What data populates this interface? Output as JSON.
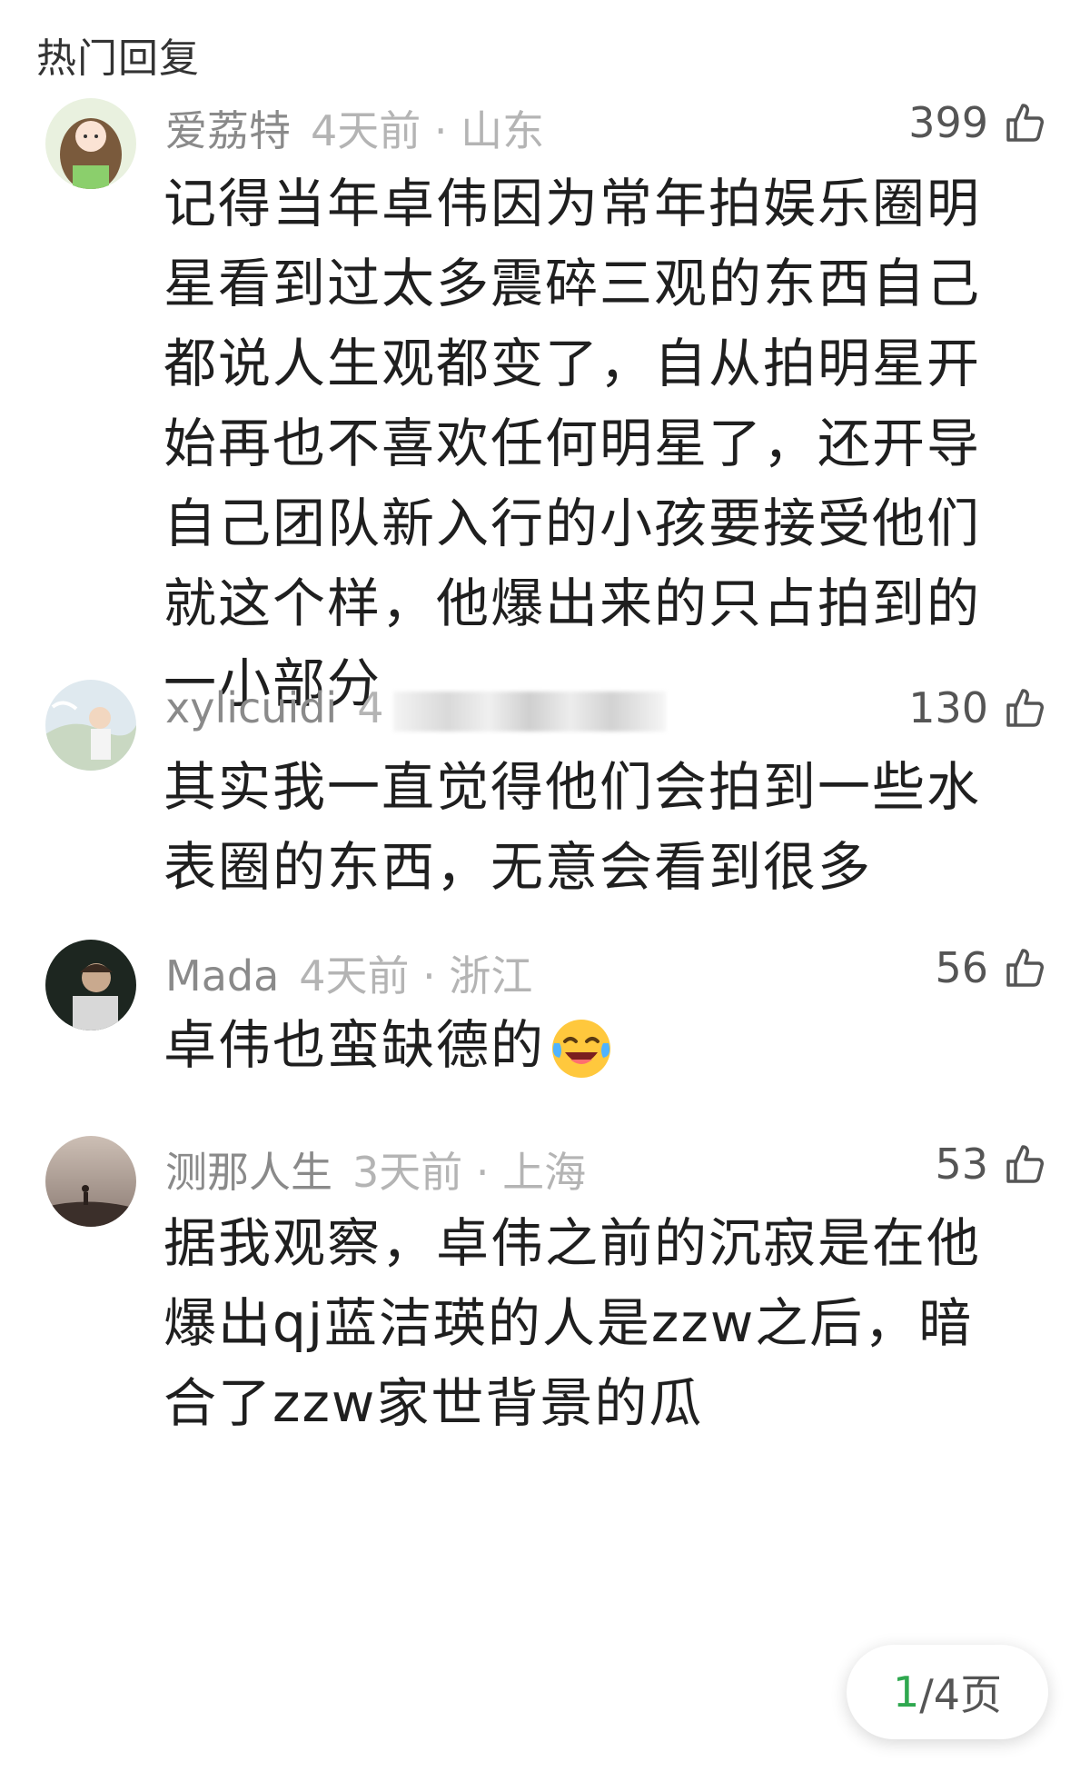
{
  "section_title": "热门回复",
  "comments": [
    {
      "username": "爱荔特",
      "time": "4天前",
      "location": "山东",
      "likes": "399",
      "text": "记得当年卓伟因为常年拍娱乐圈明星看到过太多震碎三观的东西自己都说人生观都变了，自从拍明星开始再也不喜欢任何明星了，还开导自己团队新入行的小孩要接受他们就这个样，他爆出来的只占拍到的一小部分"
    },
    {
      "username": "xylicuidi",
      "time": "4",
      "likes": "130",
      "text": "其实我一直觉得他们会拍到一些水表圈的东西，无意会看到很多"
    },
    {
      "username": "Mada",
      "time": "4天前",
      "location": "浙江",
      "likes": "56",
      "text": "卓伟也蛮缺德的",
      "emoji": "laughing-crying-emoji"
    },
    {
      "username": "测那人生",
      "time": "3天前",
      "location": "上海",
      "likes": "53",
      "text": "据我观察，卓伟之前的沉寂是在他爆出qj蓝洁瑛的人是zzw之后，暗合了zzw家世背景的瓜"
    }
  ],
  "pager": {
    "current": "1",
    "total_label": "/4页"
  },
  "colors": {
    "accent": "#2fa84f",
    "username": "#8a8a8a",
    "meta": "#b4b4b4",
    "text": "#1f1f1f"
  },
  "icons": [
    "thumbs-up-icon",
    "avatar-image"
  ]
}
